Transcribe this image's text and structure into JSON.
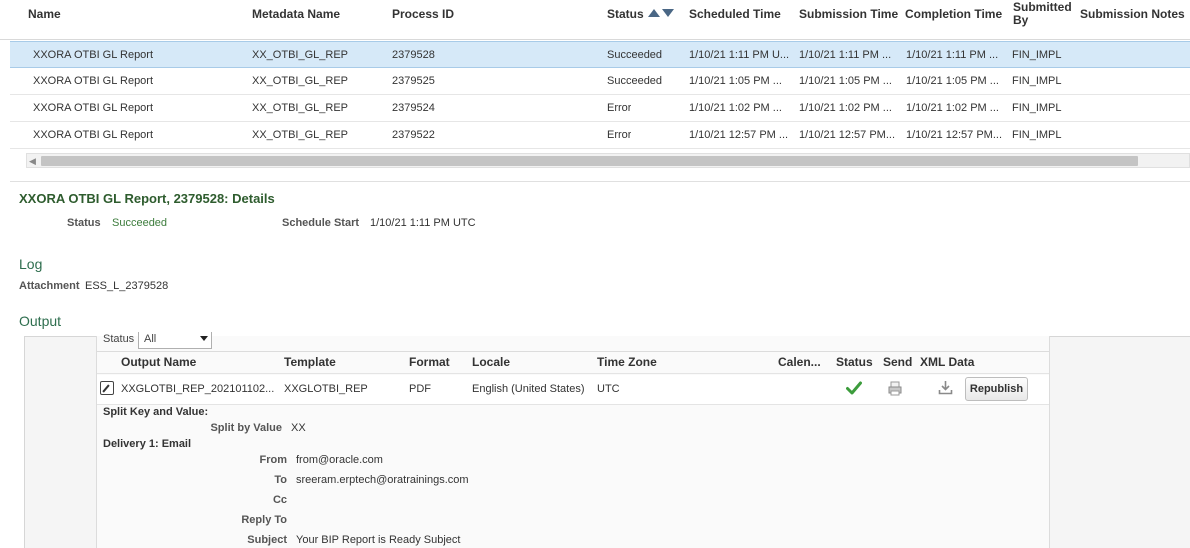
{
  "jobs_table": {
    "columns": {
      "name": "Name",
      "metadata_name": "Metadata Name",
      "process_id": "Process ID",
      "status": "Status",
      "scheduled_time": "Scheduled Time",
      "submission_time": "Submission Time",
      "completion_time": "Completion Time",
      "submitted_by_line1": "Submitted",
      "submitted_by_line2": "By",
      "submission_notes": "Submission Notes"
    },
    "rows": [
      {
        "name": "XXORA OTBI GL Report",
        "metadata_name": "XX_OTBI_GL_REP",
        "process_id": "2379528",
        "status": "Succeeded",
        "scheduled_time": "1/10/21 1:11 PM U...",
        "submission_time": "1/10/21 1:11 PM ...",
        "completion_time": "1/10/21 1:11 PM ...",
        "submitted_by": "FIN_IMPL"
      },
      {
        "name": "XXORA OTBI GL Report",
        "metadata_name": "XX_OTBI_GL_REP",
        "process_id": "2379525",
        "status": "Succeeded",
        "scheduled_time": "1/10/21 1:05 PM ...",
        "submission_time": "1/10/21 1:05 PM ...",
        "completion_time": "1/10/21 1:05 PM ...",
        "submitted_by": "FIN_IMPL"
      },
      {
        "name": "XXORA OTBI GL Report",
        "metadata_name": "XX_OTBI_GL_REP",
        "process_id": "2379524",
        "status": "Error",
        "scheduled_time": "1/10/21 1:02 PM ...",
        "submission_time": "1/10/21 1:02 PM ...",
        "completion_time": "1/10/21 1:02 PM ...",
        "submitted_by": "FIN_IMPL"
      },
      {
        "name": "XXORA OTBI GL Report",
        "metadata_name": "XX_OTBI_GL_REP",
        "process_id": "2379522",
        "status": "Error",
        "scheduled_time": "1/10/21 12:57 PM ...",
        "submission_time": "1/10/21 12:57 PM...",
        "completion_time": "1/10/21 12:57 PM...",
        "submitted_by": "FIN_IMPL"
      }
    ],
    "selected_row": 0
  },
  "details": {
    "title": "XXORA OTBI GL Report, 2379528: Details",
    "status_label": "Status",
    "status_value": "Succeeded",
    "schedule_start_label": "Schedule Start",
    "schedule_start_value": "1/10/21 1:11 PM UTC"
  },
  "log": {
    "heading": "Log",
    "attachment_label": "Attachment",
    "attachment_value": "ESS_L_2379528"
  },
  "output": {
    "heading": "Output",
    "status_filter_label": "Status",
    "status_filter_value": "All",
    "columns": {
      "output_name": "Output Name",
      "template": "Template",
      "format": "Format",
      "locale": "Locale",
      "time_zone": "Time Zone",
      "calendar": "Calen...",
      "status": "Status",
      "send": "Send",
      "xml_data": "XML Data"
    },
    "row": {
      "output_name": "XXGLOTBI_REP_202101102...",
      "template": "XXGLOTBI_REP",
      "format": "PDF",
      "locale": "English (United States)",
      "time_zone": "UTC",
      "status_icon": "check-icon",
      "send_icon": "printer-icon",
      "xml_icon": "download-icon",
      "republish_label": "Republish"
    },
    "split": {
      "title": "Split Key and Value:",
      "split_by_label": "Split by Value",
      "split_by_value": "XX"
    },
    "delivery": {
      "title": "Delivery 1: Email",
      "from_label": "From",
      "from_value": "from@oracle.com",
      "to_label": "To",
      "to_value": "sreeram.erptech@oratrainings.com",
      "cc_label": "Cc",
      "cc_value": "",
      "reply_to_label": "Reply To",
      "reply_to_value": "",
      "subject_label": "Subject",
      "subject_value": "Your BIP Report is Ready Subject"
    }
  },
  "colors": {
    "selected_row_bg": "#d6e9f8",
    "section_heading": "#2e6e4e",
    "success_green": "#3c9c3c",
    "sort_icon": "#4a6785"
  }
}
